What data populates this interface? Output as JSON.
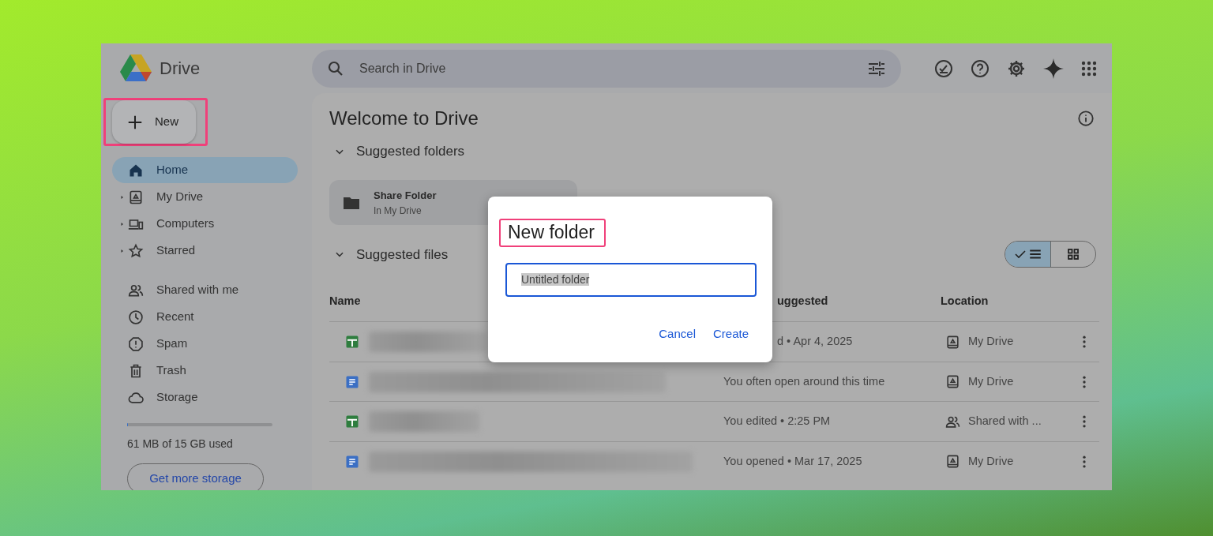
{
  "app": {
    "name": "Drive"
  },
  "search": {
    "placeholder": "Search in Drive"
  },
  "new_button": {
    "label": "New",
    "highlighted": true
  },
  "sidebar": {
    "sections": [
      [
        {
          "label": "Home",
          "kind": "home",
          "selected": true,
          "expandable": false
        },
        {
          "label": "My Drive",
          "kind": "drive",
          "selected": false,
          "expandable": true
        },
        {
          "label": "Computers",
          "kind": "computer",
          "selected": false,
          "expandable": true
        },
        {
          "label": "Starred",
          "kind": "star",
          "selected": false,
          "expandable": true
        }
      ],
      [
        {
          "label": "Shared with me",
          "kind": "people",
          "selected": false,
          "expandable": false
        },
        {
          "label": "Recent",
          "kind": "clock",
          "selected": false,
          "expandable": false
        },
        {
          "label": "Spam",
          "kind": "spam",
          "selected": false,
          "expandable": false
        },
        {
          "label": "Trash",
          "kind": "trash",
          "selected": false,
          "expandable": false
        },
        {
          "label": "Storage",
          "kind": "cloud",
          "selected": false,
          "expandable": false
        }
      ]
    ]
  },
  "storage": {
    "level": 0.004,
    "usage": "61 MB of 15 GB used",
    "button": "Get more storage"
  },
  "main": {
    "title": "Welcome to Drive",
    "folders_section": {
      "label": "Suggested folders",
      "expanded": true
    },
    "folders": [
      {
        "name": "Share Folder",
        "location": "In My Drive"
      }
    ],
    "files_section": {
      "label": "Suggested files",
      "expanded": true
    },
    "view_toggle": [
      {
        "kind": "list",
        "selected": true
      },
      {
        "kind": "grid",
        "selected": false
      }
    ],
    "table": {
      "columns": [
        {
          "label": "Name",
          "partial": false
        },
        {
          "label": "uggested",
          "partial": true
        },
        {
          "label": "Location",
          "partial": false
        }
      ],
      "rows": [
        {
          "kind": "sheet",
          "reason": "d • Apr 4, 2025",
          "reason_partial": true,
          "location": {
            "kind": "drive",
            "label": "My Drive"
          }
        },
        {
          "kind": "doc",
          "reason": "You often open around this time",
          "reason_partial": false,
          "location": {
            "kind": "drive",
            "label": "My Drive"
          }
        },
        {
          "kind": "sheet",
          "reason": "You edited • 2:25 PM",
          "reason_partial": false,
          "location": {
            "kind": "people",
            "label": "Shared with ..."
          }
        },
        {
          "kind": "doc",
          "reason": "You opened • Mar 17, 2025",
          "reason_partial": false,
          "location": {
            "kind": "drive",
            "label": "My Drive"
          }
        }
      ]
    }
  },
  "dialog": {
    "title": "New folder",
    "title_highlighted": true,
    "value": "Untitled folder",
    "buttons": [
      "Cancel",
      "Create"
    ]
  }
}
